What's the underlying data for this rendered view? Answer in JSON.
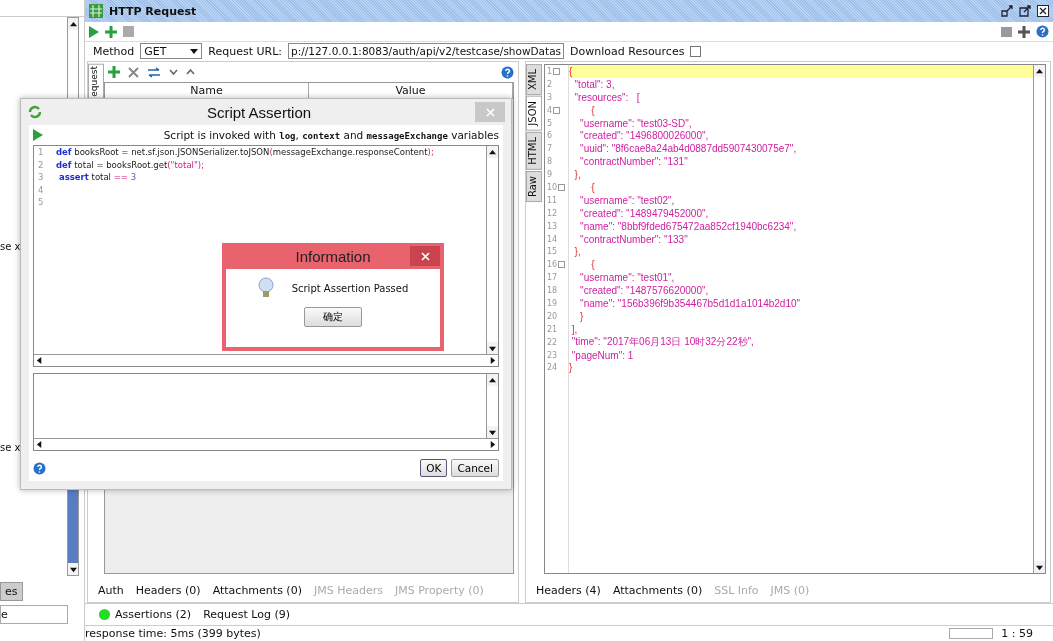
{
  "left_pane": {
    "fragments": [
      "se x",
      "se x"
    ],
    "tab": "es",
    "column": "e"
  },
  "window": {
    "title": "HTTP Request"
  },
  "request_bar": {
    "method_label": "Method",
    "method": "GET",
    "url_label": "Request URL:",
    "url": "p://127.0.0.1:8083/auth/api/v2/testcase/showDatas",
    "download_label": "Download Resources",
    "download_checked": false
  },
  "request_panel": {
    "side_tab": "equest",
    "columns": [
      "Name",
      "Value"
    ],
    "tabs": [
      {
        "label": "Auth",
        "disabled": false
      },
      {
        "label": "Headers (0)",
        "disabled": false
      },
      {
        "label": "Attachments (0)",
        "disabled": false
      },
      {
        "label": "JMS Headers",
        "disabled": true
      },
      {
        "label": "JMS Property (0)",
        "disabled": true
      }
    ]
  },
  "response_panel": {
    "side_tabs": [
      {
        "label": "XML",
        "selected": false
      },
      {
        "label": "JSON",
        "selected": true
      },
      {
        "label": "HTML",
        "selected": false
      },
      {
        "label": "Raw",
        "selected": false
      }
    ],
    "lines": [
      {
        "num": "1",
        "text": "{",
        "kind": "bracket",
        "fold": true,
        "current": true
      },
      {
        "num": "2",
        "text": "  \"total\": 3,",
        "kind": "pair",
        "fold": false,
        "current": false
      },
      {
        "num": "3",
        "text": "  \"resources\":   [",
        "kind": "pair",
        "fold": false,
        "current": false
      },
      {
        "num": "4",
        "text": "        {",
        "kind": "bracket",
        "fold": true,
        "current": false
      },
      {
        "num": "5",
        "text": "    \"username\": \"test03-SD\",",
        "kind": "pair",
        "fold": false,
        "current": false
      },
      {
        "num": "6",
        "text": "    \"created\": \"1496800026000\",",
        "kind": "pair",
        "fold": false,
        "current": false
      },
      {
        "num": "7",
        "text": "    \"uuid\": \"8f6cae8a24ab4d0887dd5907430075e7\",",
        "kind": "pair",
        "fold": false,
        "current": false
      },
      {
        "num": "8",
        "text": "    \"contractNumber\": \"131\"",
        "kind": "pair",
        "fold": false,
        "current": false
      },
      {
        "num": "9",
        "text": "  },",
        "kind": "bracket",
        "fold": false,
        "current": false
      },
      {
        "num": "10",
        "text": "        {",
        "kind": "bracket",
        "fold": true,
        "current": false
      },
      {
        "num": "11",
        "text": "    \"username\": \"test02\",",
        "kind": "pair",
        "fold": false,
        "current": false
      },
      {
        "num": "12",
        "text": "    \"created\": \"1489479452000\",",
        "kind": "pair",
        "fold": false,
        "current": false
      },
      {
        "num": "13",
        "text": "    \"name\": \"8bbf9fded675472aa852cf1940bc6234\",",
        "kind": "pair",
        "fold": false,
        "current": false
      },
      {
        "num": "14",
        "text": "    \"contractNumber\": \"133\"",
        "kind": "pair",
        "fold": false,
        "current": false
      },
      {
        "num": "15",
        "text": "  },",
        "kind": "bracket",
        "fold": false,
        "current": false
      },
      {
        "num": "16",
        "text": "        {",
        "kind": "bracket",
        "fold": true,
        "current": false
      },
      {
        "num": "17",
        "text": "    \"username\": \"test01\",",
        "kind": "pair",
        "fold": false,
        "current": false
      },
      {
        "num": "18",
        "text": "    \"created\": \"1487576620000\",",
        "kind": "pair",
        "fold": false,
        "current": false
      },
      {
        "num": "19",
        "text": "    \"name\": \"156b396f9b354467b5d1d1a1014b2d10\"",
        "kind": "pair",
        "fold": false,
        "current": false
      },
      {
        "num": "20",
        "text": "    }",
        "kind": "bracket",
        "fold": false,
        "current": false
      },
      {
        "num": "21",
        "text": " ],",
        "kind": "bracket",
        "fold": false,
        "current": false
      },
      {
        "num": "22",
        "text": " \"time\": \"2017年06月13日 10时32分22秒\",",
        "kind": "pair",
        "fold": false,
        "current": false
      },
      {
        "num": "23",
        "text": " \"pageNum\": 1",
        "kind": "pair",
        "fold": false,
        "current": false
      },
      {
        "num": "24",
        "text": "}",
        "kind": "bracket",
        "fold": false,
        "current": false
      }
    ],
    "tabs": [
      {
        "label": "Headers (4)",
        "disabled": false
      },
      {
        "label": "Attachments (0)",
        "disabled": false
      },
      {
        "label": "SSL Info",
        "disabled": true
      },
      {
        "label": "JMS (0)",
        "disabled": true
      }
    ]
  },
  "bottom_tabs": [
    {
      "label": "Assertions (2)",
      "color": "#22dd22"
    },
    {
      "label": "Request Log (9)"
    }
  ],
  "status_bar": {
    "text": "response time: 5ms (399 bytes)",
    "position": "1 : 59"
  },
  "script_dialog": {
    "title": "Script Assertion",
    "hint": [
      {
        "text": "Script is invoked with ",
        "kind": "plain"
      },
      {
        "text": "log",
        "kind": "code"
      },
      {
        "text": ", ",
        "kind": "plain"
      },
      {
        "text": "context",
        "kind": "code"
      },
      {
        "text": " and ",
        "kind": "plain"
      },
      {
        "text": "messageExchange",
        "kind": "code"
      },
      {
        "text": " variables",
        "kind": "plain"
      }
    ],
    "lines": [
      {
        "num": "1",
        "tokens": [
          {
            "text": "def",
            "kind": "keyword"
          },
          {
            "text": " booksRoot = net.sf.json.JSONSerializer.toJSON",
            "kind": "plain"
          },
          {
            "text": "(",
            "kind": "string"
          },
          {
            "text": "messageExchange.responseContent",
            "kind": "plain"
          },
          {
            "text": ");",
            "kind": "string"
          }
        ]
      },
      {
        "num": "2",
        "tokens": [
          {
            "text": "def",
            "kind": "keyword"
          },
          {
            "text": " total = booksRoot.get",
            "kind": "plain"
          },
          {
            "text": "(\"total\");",
            "kind": "string"
          }
        ]
      },
      {
        "num": "3",
        "tokens": [
          {
            "text": " assert",
            "kind": "keyword"
          },
          {
            "text": " total ",
            "kind": "plain"
          },
          {
            "text": "==",
            "kind": "string"
          },
          {
            "text": " 3",
            "kind": "number"
          }
        ]
      },
      {
        "num": "4"
      },
      {
        "num": "5"
      }
    ],
    "buttons": [
      {
        "label": "OK",
        "default": true
      },
      {
        "label": "Cancel",
        "default": false
      }
    ]
  },
  "info_dialog": {
    "title": "Information",
    "message": "Script Assertion Passed",
    "button": "确定"
  }
}
